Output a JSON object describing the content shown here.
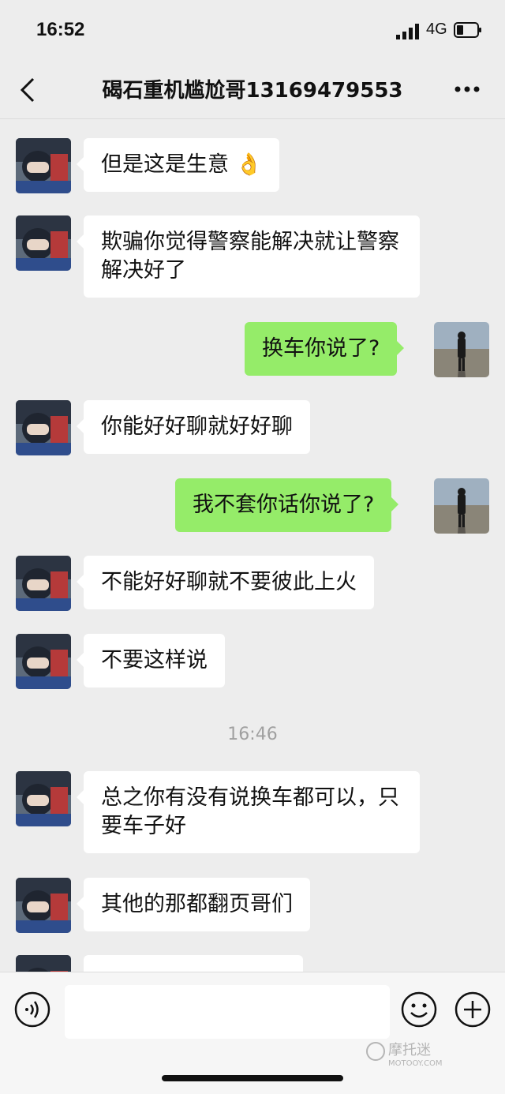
{
  "status_bar": {
    "time": "16:52",
    "network": "4G"
  },
  "nav": {
    "title": "碣石重机尴尬哥13169479553"
  },
  "messages": [
    {
      "side": "in",
      "text": "但是这是生意"
    },
    {
      "side": "in",
      "text": "欺骗你觉得警察能解决就让警察解决好了"
    },
    {
      "side": "out",
      "text": "换车你说了?"
    },
    {
      "side": "in",
      "text": "你能好好聊就好好聊"
    },
    {
      "side": "out",
      "text": "我不套你话你说了?"
    },
    {
      "side": "in",
      "text": "不能好好聊就不要彼此上火"
    },
    {
      "side": "in",
      "text": "不要这样说"
    },
    {
      "side": "in",
      "text": "总之你有没有说换车都可以，只要车子好"
    },
    {
      "side": "in",
      "text": "其他的那都翻页哥们"
    }
  ],
  "timestamp": "16:46",
  "emoji": "👌",
  "watermark": {
    "main": "摩托迷",
    "sub": "MOTOOY.COM"
  },
  "icons": [
    "back-icon",
    "more-icon",
    "voice-icon",
    "emoji-icon",
    "plus-icon"
  ]
}
